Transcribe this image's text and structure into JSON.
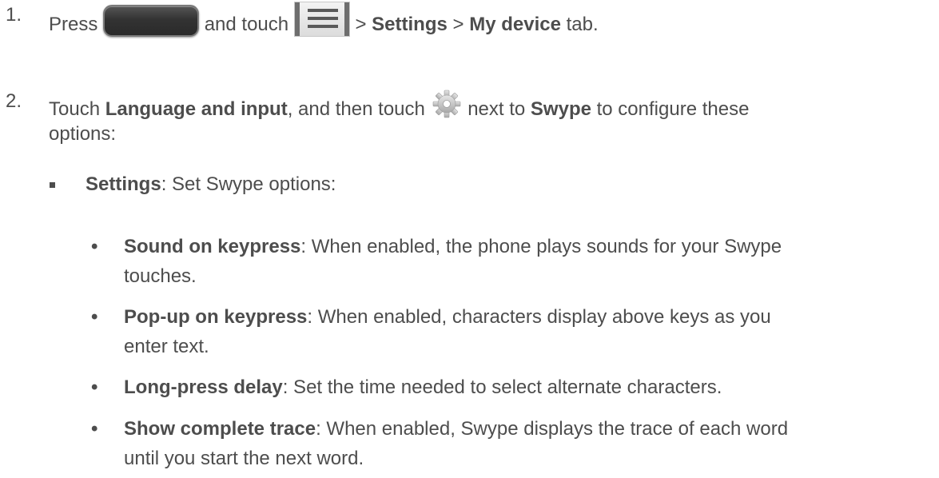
{
  "step1": {
    "number": "1.",
    "press": "Press",
    "and_touch": "and touch",
    "sep1": ">",
    "settings": "Settings",
    "sep2": ">",
    "my_device": "My device",
    "tab": "tab."
  },
  "step2": {
    "number": "2.",
    "touch": "Touch",
    "language_and_input": "Language and input",
    "and_then_touch": ", and then touch",
    "next_to": "next to",
    "swype": "Swype",
    "configure": "to configure these",
    "options": "options:"
  },
  "settings_item": {
    "label": "Settings",
    "text": ": Set Swype options:"
  },
  "sub_items": [
    {
      "label": "Sound on keypress",
      "line1": ": When enabled, the phone plays sounds for your Swype",
      "line2": "touches."
    },
    {
      "label": "Pop-up on keypress",
      "line1": ": When enabled, characters display above keys as you",
      "line2": "enter text."
    },
    {
      "label": "Long-press delay",
      "line1": ": Set the time needed to select alternate characters.",
      "line2": ""
    },
    {
      "label": "Show complete trace",
      "line1": ": When enabled, Swype displays the trace of each word",
      "line2": "until you start the next word."
    }
  ],
  "icons": {
    "home_key": "home-key-icon",
    "menu_key": "menu-key-icon",
    "gear": "gear-icon"
  }
}
